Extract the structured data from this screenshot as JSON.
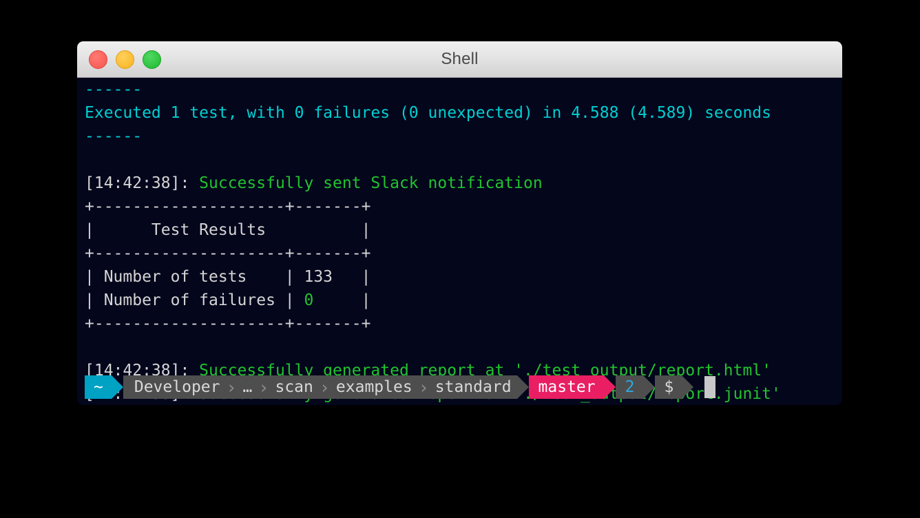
{
  "window": {
    "title": "Shell",
    "controls": [
      {
        "name": "close",
        "color": "#f4554d"
      },
      {
        "name": "minimize",
        "color": "#f9b21f"
      },
      {
        "name": "zoom",
        "color": "#1fb82f"
      }
    ]
  },
  "colors": {
    "background": "#04061c",
    "cyan": "#00cfd1",
    "green": "#22c32e",
    "white": "#d4d4d4",
    "prompt_home_bg": "#00a2c4",
    "prompt_path_bg": "#4e4e4e",
    "prompt_git_bg": "#e91e63",
    "prompt_jobs_fg": "#2fa8e0",
    "cursor": "#c8c8c8"
  },
  "terminal": {
    "lines": [
      {
        "id": "rule-top",
        "segments": [
          {
            "text": "------",
            "color": "cyan"
          }
        ]
      },
      {
        "id": "summary",
        "segments": [
          {
            "text": "Executed 1 test, with 0 failures (0 unexpected) in 4.588 (4.589) seconds",
            "color": "cyan"
          }
        ]
      },
      {
        "id": "rule-bottom",
        "segments": [
          {
            "text": "------",
            "color": "cyan"
          }
        ]
      },
      {
        "id": "spacer-1",
        "segments": [
          {
            "text": " ",
            "color": "white"
          }
        ]
      },
      {
        "id": "log-slack",
        "segments": [
          {
            "text": "[14:42:38]: ",
            "color": "white"
          },
          {
            "text": "Successfully sent Slack notification",
            "color": "green"
          }
        ]
      },
      {
        "id": "table-top",
        "segments": [
          {
            "text": "+--------------------+-------+",
            "color": "white"
          }
        ]
      },
      {
        "id": "table-title",
        "segments": [
          {
            "text": "|      Test Results          |",
            "color": "white"
          }
        ]
      },
      {
        "id": "table-sep",
        "segments": [
          {
            "text": "+--------------------+-------+",
            "color": "white"
          }
        ]
      },
      {
        "id": "table-row-tests",
        "segments": [
          {
            "text": "| Number of tests    | 133   |",
            "color": "white"
          }
        ]
      },
      {
        "id": "table-row-failures",
        "segments": [
          {
            "text": "| Number of failures | ",
            "color": "white"
          },
          {
            "text": "0",
            "color": "green"
          },
          {
            "text": "     |",
            "color": "white"
          }
        ]
      },
      {
        "id": "table-bottom",
        "segments": [
          {
            "text": "+--------------------+-------+",
            "color": "white"
          }
        ]
      },
      {
        "id": "spacer-2",
        "segments": [
          {
            "text": " ",
            "color": "white"
          }
        ]
      },
      {
        "id": "log-report-html",
        "segments": [
          {
            "text": "[14:42:38]: ",
            "color": "white"
          },
          {
            "text": "Successfully generated report at './test_output/report.html'",
            "color": "green"
          }
        ]
      },
      {
        "id": "log-report-junit",
        "segments": [
          {
            "text": "[14:42:38]: ",
            "color": "white"
          },
          {
            "text": "Successfully generated report at './test_output/report.junit'",
            "color": "green"
          }
        ]
      }
    ]
  },
  "table_data": {
    "title": "Test Results",
    "rows": [
      {
        "label": "Number of tests",
        "value": "133"
      },
      {
        "label": "Number of failures",
        "value": "0"
      }
    ]
  },
  "prompt": {
    "home": "~",
    "breadcrumbs": [
      "Developer",
      "…",
      "scan",
      "examples",
      "standard"
    ],
    "separator": "›",
    "git_branch": "master",
    "jobs": "2",
    "symbol": "$",
    "input_value": ""
  }
}
